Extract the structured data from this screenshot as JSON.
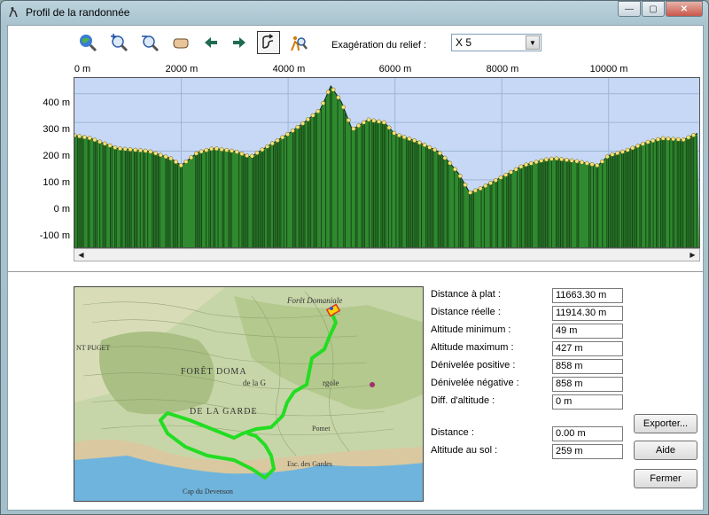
{
  "window": {
    "title": "Profil de la randonnée",
    "buttons": {
      "minimize": "—",
      "maximize": "▢",
      "close": "✕"
    }
  },
  "toolbar": {
    "tools": [
      {
        "icon": "globe-zoom-icon"
      },
      {
        "icon": "zoom-in-icon"
      },
      {
        "icon": "zoom-out-icon"
      },
      {
        "icon": "hand-pan-icon"
      },
      {
        "icon": "arrow-left-icon"
      },
      {
        "icon": "arrow-right-icon"
      },
      {
        "icon": "profile-path-icon",
        "active": true
      },
      {
        "icon": "walker-zoom-icon"
      }
    ],
    "relief_label": "Exagération du relief :",
    "relief_value": "X 5"
  },
  "colors": {
    "profile_fill": "#2f8a2f",
    "profile_stripe": "#103010",
    "sky": "#c6d8f6",
    "point": "#f2e27a",
    "route": "#22dd22"
  },
  "chart_data": {
    "type": "area",
    "x_ticks": [
      "0 m",
      "2000 m",
      "4000 m",
      "6000 m",
      "8000 m",
      "10000 m"
    ],
    "y_ticks": [
      "400 m",
      "300 m",
      "200 m",
      "100 m",
      "0 m",
      "-100 m"
    ],
    "xlim": [
      0,
      11663.3
    ],
    "ylim": [
      -135,
      455
    ],
    "x": [
      0,
      300,
      800,
      1400,
      1800,
      2000,
      2300,
      2600,
      3000,
      3300,
      3600,
      4000,
      4300,
      4600,
      4700,
      4800,
      5000,
      5200,
      5500,
      5800,
      6000,
      6400,
      6800,
      7000,
      7200,
      7400,
      7600,
      8000,
      8400,
      8800,
      9000,
      9400,
      9800,
      10000,
      10300,
      10700,
      11000,
      11400,
      11663
    ],
    "y": [
      255,
      245,
      210,
      200,
      175,
      150,
      195,
      210,
      200,
      180,
      215,
      260,
      300,
      345,
      385,
      427,
      370,
      275,
      310,
      300,
      260,
      235,
      200,
      165,
      120,
      55,
      70,
      110,
      150,
      170,
      175,
      165,
      150,
      185,
      200,
      230,
      245,
      240,
      262
    ]
  },
  "stats": [
    {
      "label": "Distance à plat :",
      "value": "11663.30 m"
    },
    {
      "label": "Distance réelle :",
      "value": "11914.30 m"
    },
    {
      "label": "Altitude minimum :",
      "value": "49 m"
    },
    {
      "label": "Altitude maximum :",
      "value": "427 m"
    },
    {
      "label": "Dénivelée positive :",
      "value": "858 m"
    },
    {
      "label": "Dénivelée négative :",
      "value": "858 m"
    },
    {
      "label": "Diff. d'altitude :",
      "value": "0 m"
    }
  ],
  "cursor": [
    {
      "label": "Distance :",
      "value": "0.00 m"
    },
    {
      "label": "Altitude au sol :",
      "value": "259 m"
    }
  ],
  "actions": {
    "export": "Exporter...",
    "help": "Aide",
    "close": "Fermer"
  },
  "map": {
    "labels": [
      "Forêt Domaniale",
      "FORÊT DOMA",
      "de la G",
      "rgole",
      "DE LA GARDE",
      "NT PUGET",
      "Cap du Devenson",
      "Pomet",
      "Esc. des Gardes"
    ]
  }
}
